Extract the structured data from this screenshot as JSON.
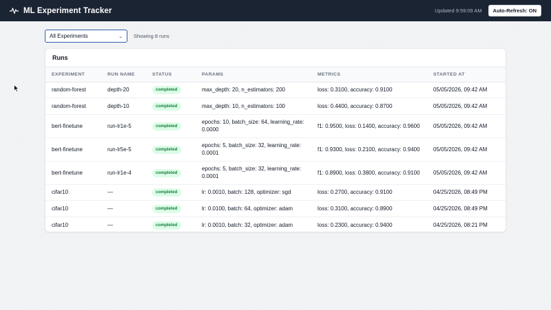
{
  "header": {
    "title": "ML Experiment Tracker",
    "logo_icon": "activity-pulse-icon",
    "updated": "Updated 9:59:09 AM",
    "auto_refresh": "Auto-Refresh: ON"
  },
  "filter": {
    "selected": "All Experiments",
    "showing": "Showing 8 runs"
  },
  "runs": {
    "title": "Runs",
    "columns": [
      "EXPERIMENT",
      "RUN NAME",
      "STATUS",
      "PARAMS",
      "METRICS",
      "STARTED AT"
    ],
    "rows": [
      {
        "experiment": "random-forest",
        "run_name": "depth-20",
        "status": "completed",
        "params": "max_depth: 20, n_estimators: 200",
        "metrics": "loss: 0.3100, accuracy: 0.9100",
        "started": "05/05/2026, 09:42 AM"
      },
      {
        "experiment": "random-forest",
        "run_name": "depth-10",
        "status": "completed",
        "params": "max_depth: 10, n_estimators: 100",
        "metrics": "loss: 0.4400, accuracy: 0.8700",
        "started": "05/05/2026, 09:42 AM"
      },
      {
        "experiment": "bert-finetune",
        "run_name": "run-lr1e-5",
        "status": "completed",
        "params": "epochs: 10, batch_size: 64, learning_rate: 0.0000",
        "metrics": "f1: 0.9500, loss: 0.1400, accuracy: 0.9600",
        "started": "05/05/2026, 09:42 AM"
      },
      {
        "experiment": "bert-finetune",
        "run_name": "run-lr5e-5",
        "status": "completed",
        "params": "epochs: 5, batch_size: 32, learning_rate: 0.0001",
        "metrics": "f1: 0.9300, loss: 0.2100, accuracy: 0.9400",
        "started": "05/05/2026, 09:42 AM"
      },
      {
        "experiment": "bert-finetune",
        "run_name": "run-lr1e-4",
        "status": "completed",
        "params": "epochs: 5, batch_size: 32, learning_rate: 0.0001",
        "metrics": "f1: 0.8900, loss: 0.3800, accuracy: 0.9100",
        "started": "05/05/2026, 09:42 AM"
      },
      {
        "experiment": "cifar10",
        "run_name": "—",
        "status": "completed",
        "params": "lr: 0.0010, batch: 128, optimizer: sgd",
        "metrics": "loss: 0.2700, accuracy: 0.9100",
        "started": "04/25/2026, 08:49 PM"
      },
      {
        "experiment": "cifar10",
        "run_name": "—",
        "status": "completed",
        "params": "lr: 0.0100, batch: 64, optimizer: adam",
        "metrics": "loss: 0.3100, accuracy: 0.8900",
        "started": "04/25/2026, 08:49 PM"
      },
      {
        "experiment": "cifar10",
        "run_name": "—",
        "status": "completed",
        "params": "lr: 0.0010, batch: 32, optimizer: adam",
        "metrics": "loss: 0.2300, accuracy: 0.9400",
        "started": "04/25/2026, 08:21 PM"
      }
    ]
  },
  "colors": {
    "topbar": "#1b2433",
    "accent": "#2f5fa8",
    "status_completed_bg": "#dcfce7",
    "status_completed_text": "#15803d"
  }
}
